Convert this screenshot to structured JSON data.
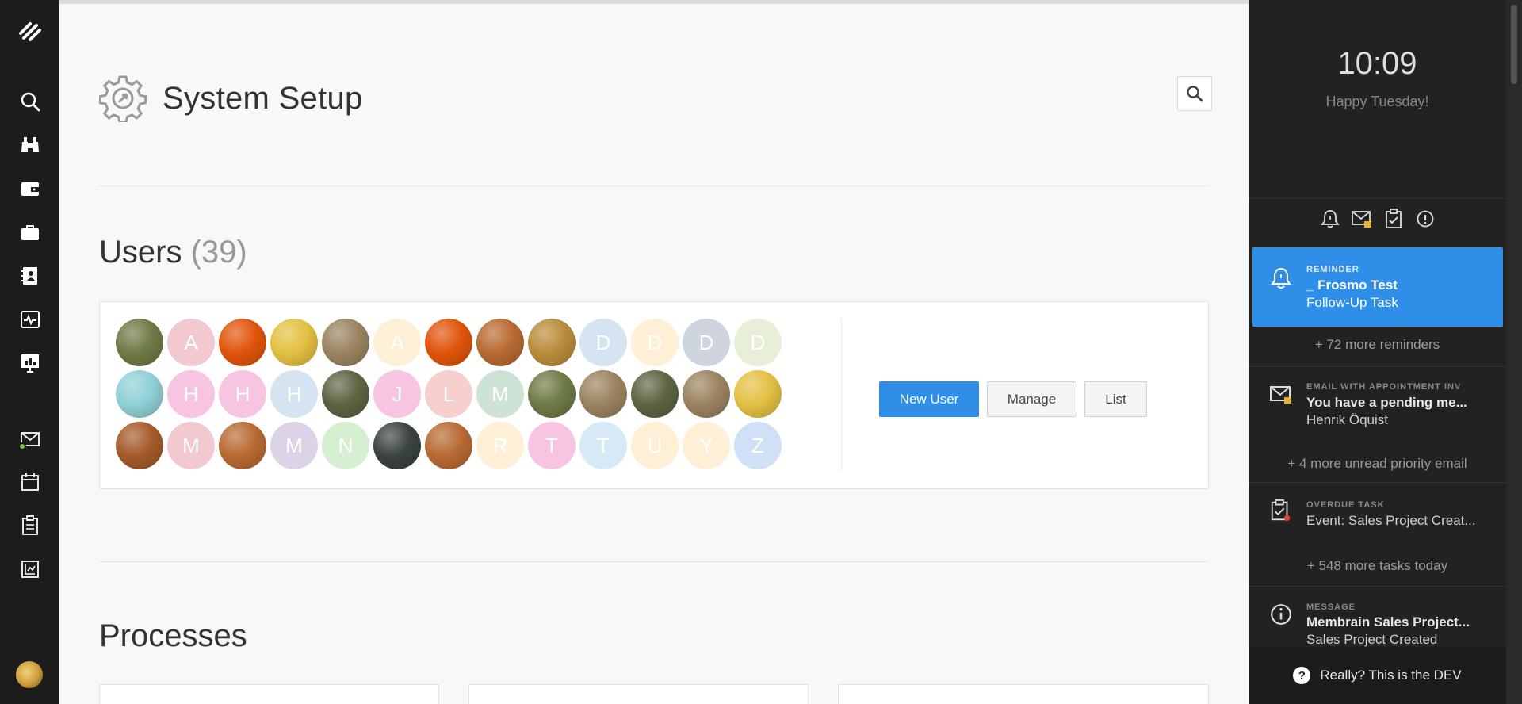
{
  "page": {
    "title": "System Setup"
  },
  "users": {
    "heading": "Users",
    "count": "(39)",
    "rows": [
      [
        {
          "type": "photo",
          "color": "#6e7a46",
          "letter": ""
        },
        {
          "type": "letter",
          "color": "#f2c9cf",
          "letter": "A"
        },
        {
          "type": "photo",
          "color": "#e0540a",
          "letter": ""
        },
        {
          "type": "photo",
          "color": "#e3c042",
          "letter": ""
        },
        {
          "type": "photo",
          "color": "#9a8360",
          "letter": ""
        },
        {
          "type": "letter",
          "color": "#fdf0d6",
          "letter": "A"
        },
        {
          "type": "photo",
          "color": "#e0540a",
          "letter": ""
        },
        {
          "type": "photo",
          "color": "#b86a32",
          "letter": ""
        },
        {
          "type": "photo",
          "color": "#b98c3a",
          "letter": ""
        },
        {
          "type": "letter",
          "color": "#d6e4f2",
          "letter": "D"
        },
        {
          "type": "letter",
          "color": "#fdf0d6",
          "letter": "D"
        },
        {
          "type": "letter",
          "color": "#ced5df",
          "letter": "D"
        },
        {
          "type": "letter",
          "color": "#e7efd6",
          "letter": "D"
        }
      ],
      [
        {
          "type": "photo",
          "color": "#8fd0d6",
          "letter": ""
        },
        {
          "type": "letter",
          "color": "#f7c4e1",
          "letter": "H"
        },
        {
          "type": "letter",
          "color": "#f7c4e1",
          "letter": "H"
        },
        {
          "type": "letter",
          "color": "#d6e4f2",
          "letter": "H"
        },
        {
          "type": "photo",
          "color": "#5e6342",
          "letter": ""
        },
        {
          "type": "letter",
          "color": "#f7c4e1",
          "letter": "J"
        },
        {
          "type": "letter",
          "color": "#f7cfcf",
          "letter": "L"
        },
        {
          "type": "letter",
          "color": "#cfe2d6",
          "letter": "M"
        },
        {
          "type": "photo",
          "color": "#6e7a46",
          "letter": ""
        },
        {
          "type": "photo",
          "color": "#9a8360",
          "letter": ""
        },
        {
          "type": "photo",
          "color": "#5e6342",
          "letter": ""
        },
        {
          "type": "photo",
          "color": "#9a8360",
          "letter": ""
        },
        {
          "type": "photo",
          "color": "#e3c042",
          "letter": ""
        }
      ],
      [
        {
          "type": "photo",
          "color": "#a55a2a",
          "letter": ""
        },
        {
          "type": "letter",
          "color": "#f2c9cf",
          "letter": "M"
        },
        {
          "type": "photo",
          "color": "#b86a32",
          "letter": ""
        },
        {
          "type": "letter",
          "color": "#ddd3e6",
          "letter": "M"
        },
        {
          "type": "letter",
          "color": "#d6efd0",
          "letter": "N"
        },
        {
          "type": "photo",
          "color": "#3a4242",
          "letter": ""
        },
        {
          "type": "photo",
          "color": "#b86a32",
          "letter": ""
        },
        {
          "type": "letter",
          "color": "#fdf0d6",
          "letter": "R"
        },
        {
          "type": "letter",
          "color": "#f7c4e1",
          "letter": "T"
        },
        {
          "type": "letter",
          "color": "#d6eaf5",
          "letter": "T"
        },
        {
          "type": "letter",
          "color": "#fdf0d6",
          "letter": "U"
        },
        {
          "type": "letter",
          "color": "#fdf0d6",
          "letter": "Y"
        },
        {
          "type": "letter",
          "color": "#d2e0f7",
          "letter": "Z"
        }
      ]
    ],
    "buttons": {
      "new_user": "New User",
      "manage": "Manage",
      "list": "List"
    }
  },
  "processes": {
    "heading": "Processes"
  },
  "right_panel": {
    "time": "10:09",
    "greeting": "Happy Tuesday!",
    "notifications": [
      {
        "type": "Reminder",
        "title": "_ Frosmo Test",
        "subtitle": "Follow-Up Task",
        "icon": "bell-icon",
        "active": true
      },
      {
        "type": "Email with appointment inv",
        "title": "You have a pending me...",
        "subtitle": "Henrik Öquist",
        "icon": "envelope-lock-icon",
        "active": false
      },
      {
        "type": "Overdue task",
        "title": "",
        "subtitle": "Event: Sales Project Creat...",
        "icon": "clipboard-alert-icon",
        "active": false
      },
      {
        "type": "Message",
        "title": "Membrain Sales Project...",
        "subtitle": "Sales Project Created",
        "icon": "info-icon",
        "active": false
      }
    ],
    "more_reminders": "+ 72 more reminders",
    "more_emails": "+ 4 more unread priority email",
    "more_tasks": "+ 548 more tasks today",
    "footer": "Really? This is the DEV",
    "footer_icon": "?"
  },
  "colors": {
    "accent": "#2f8fe8",
    "nav_bg": "#1c1c1c",
    "panel_bg": "#222222",
    "online_dot": "#7cc242"
  }
}
